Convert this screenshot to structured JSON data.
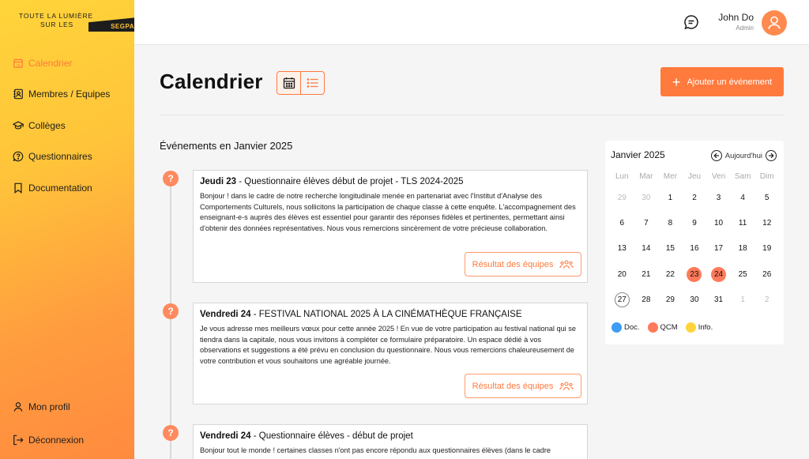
{
  "brand": {
    "line1": "TOUTE LA LUMIÈRE",
    "line2": "SUR LES",
    "badge": "SEGPA"
  },
  "nav": {
    "items": [
      {
        "label": "Calendrier",
        "icon": "calendar-icon",
        "active": true
      },
      {
        "label": "Membres / Equipes",
        "icon": "contacts-icon"
      },
      {
        "label": "Collèges",
        "icon": "graduation-cap-icon"
      },
      {
        "label": "Questionnaires",
        "icon": "question-icon"
      },
      {
        "label": "Documentation",
        "icon": "bookmark-icon"
      }
    ],
    "bottom": [
      {
        "label": "Mon profil",
        "icon": "user-icon"
      },
      {
        "label": "Déconnexion",
        "icon": "logout-icon"
      }
    ]
  },
  "header": {
    "user_name": "John Do",
    "user_role": "Admin"
  },
  "page": {
    "title": "Calendrier",
    "add_button": "Ajouter un événement",
    "events_heading": "Événements en Janvier 2025"
  },
  "events": [
    {
      "day": "Jeudi 23",
      "title": " - Questionnaire élèves début de projet - TLS 2024-2025",
      "body": "Bonjour ! dans le cadre de notre recherche longitudinale menée en partenariat avec l'Institut d'Analyse des Comportements Culturels, nous sollicitons la participation de chaque classe à cette enquête. L'accompagnement des enseignant-e-s auprès des élèves est essentiel pour garantir des réponses fidèles et pertinentes, permettant ainsi d'obtenir des données représentatives. Nous vous remercions sincèrement de votre précieuse collaboration.",
      "button": "Résultat des équipes"
    },
    {
      "day": "Vendredi 24",
      "title": " - FESTIVAL NATIONAL 2025  À LA CINÉMATHÈQUE FRANÇAISE",
      "body": "Je vous adresse mes meilleurs vœux pour cette année 2025 ! En vue de votre participation au festival national qui se tiendra dans la capitale, nous vous invitons à compléter ce formulaire préparatoire. Un espace dédié à vos observations et suggestions a été prévu en conclusion du questionnaire. Nous vous remercions chaleureusement de votre contribution et vous souhaitons une agréable journée.",
      "button": "Résultat des équipes"
    },
    {
      "day": "Vendredi 24",
      "title": " - Questionnaire élèves - début de projet",
      "body": "Bonjour tout le monde ! certaines classes n'ont pas encore répondu aux questionnaires élèves (dans le cadre"
    }
  ],
  "calendar": {
    "month": "Janvier 2025",
    "today_label": "Aujourd'hui",
    "weekdays": [
      "Lun",
      "Mar",
      "Mer",
      "Jeu",
      "Ven",
      "Sam",
      "Dim"
    ],
    "days": [
      {
        "d": "29",
        "m": true
      },
      {
        "d": "30",
        "m": true
      },
      {
        "d": "1"
      },
      {
        "d": "2"
      },
      {
        "d": "3"
      },
      {
        "d": "4"
      },
      {
        "d": "5"
      },
      {
        "d": "6"
      },
      {
        "d": "7"
      },
      {
        "d": "8"
      },
      {
        "d": "9"
      },
      {
        "d": "10"
      },
      {
        "d": "11"
      },
      {
        "d": "12"
      },
      {
        "d": "13"
      },
      {
        "d": "14"
      },
      {
        "d": "15"
      },
      {
        "d": "16"
      },
      {
        "d": "17"
      },
      {
        "d": "18"
      },
      {
        "d": "19"
      },
      {
        "d": "20"
      },
      {
        "d": "21"
      },
      {
        "d": "22"
      },
      {
        "d": "23",
        "e": true
      },
      {
        "d": "24",
        "e": true
      },
      {
        "d": "25"
      },
      {
        "d": "26"
      },
      {
        "d": "27",
        "t": true
      },
      {
        "d": "28"
      },
      {
        "d": "29"
      },
      {
        "d": "30"
      },
      {
        "d": "31"
      },
      {
        "d": "1",
        "m": true
      },
      {
        "d": "2",
        "m": true
      }
    ],
    "legend": [
      {
        "label": "Doc.",
        "color": "#3d9cf5"
      },
      {
        "label": "QCM",
        "color": "#ff7a5a"
      },
      {
        "label": "Info.",
        "color": "#ffd43a"
      }
    ]
  },
  "colors": {
    "accent": "#ff7a3d",
    "event": "#ff7a5a"
  }
}
